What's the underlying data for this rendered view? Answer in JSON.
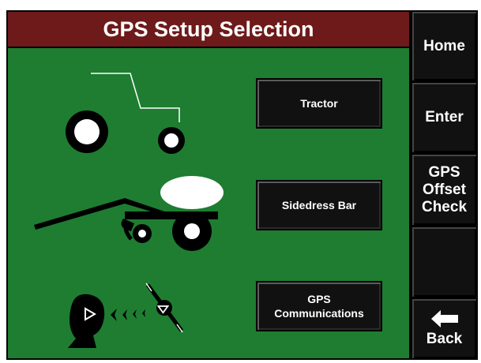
{
  "title": "GPS Setup Selection",
  "selections": {
    "tractor": "Tractor",
    "sidedress": "Sidedress Bar",
    "comm_line1": "GPS",
    "comm_line2": "Communications"
  },
  "sidebar": {
    "home": "Home",
    "enter": "Enter",
    "gps_offset_line1": "GPS",
    "gps_offset_line2": "Offset",
    "gps_offset_line3": "Check",
    "back": "Back"
  },
  "icons": {
    "tractor": "tractor-icon",
    "sidedress": "sidedress-bar-icon",
    "comm": "gps-communications-icon",
    "back": "left-arrow-icon"
  },
  "colors": {
    "title_bar": "#6e1a1a",
    "content_bg": "#1e7d31",
    "button_bg": "#111111"
  }
}
